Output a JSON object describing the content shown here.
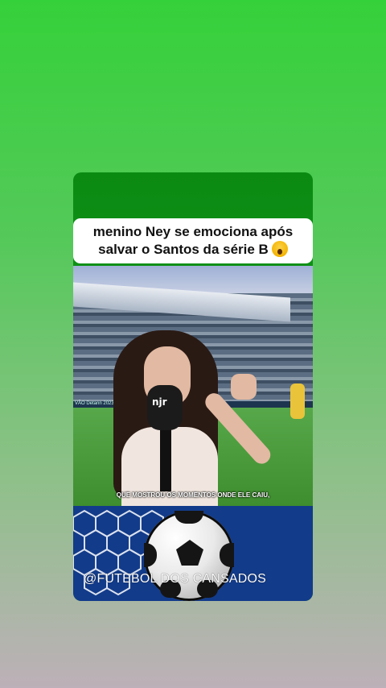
{
  "post": {
    "headline_line1": "menino Ney se emociona após",
    "headline_line2": "salvar o Santos da série B",
    "headline_emoji": "face-screaming-in-fear-emoji"
  },
  "video": {
    "subtitle": "QUE MOSTROU OS MOMENTOS ONDE ELE CAIU,",
    "mic_logo": "njr",
    "banner_text": "VÃO Detann 2023"
  },
  "footer": {
    "watermark": "@FUTEBOL DOS CANSADOS",
    "icon": "soccer-ball-icon"
  },
  "colors": {
    "background_top": "#35d13a",
    "card_green": "#0b8a12",
    "footer_blue": "#123b8a",
    "headline_bg": "#ffffff"
  }
}
